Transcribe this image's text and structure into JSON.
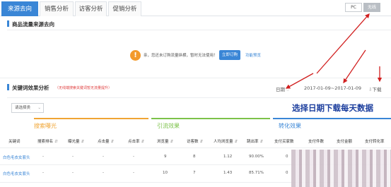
{
  "tabs": [
    {
      "label": "来源去向",
      "active": true
    },
    {
      "label": "销售分析",
      "active": false
    },
    {
      "label": "访客分析",
      "active": false
    },
    {
      "label": "促销分析",
      "active": false
    }
  ],
  "device_switch": {
    "pc": "PC",
    "wireless": "无线",
    "selected": "wireless"
  },
  "section_flow": {
    "title": "商品流量来源去向"
  },
  "notice": {
    "icon": "!",
    "text": "亲，您还未订购流量纵横，暂时无法使用！",
    "button": "立即订购",
    "link": "功能预览"
  },
  "section_keywords": {
    "title": "关键词效果分析",
    "note": "（无线端搜索关键词暂无流量提升）",
    "date_label": "日期",
    "date_range": "2017-01-09~2017-01-09",
    "download": "下载"
  },
  "filter": {
    "value": "请选择类"
  },
  "annotation": "选择日期下载每天数据",
  "groups": [
    {
      "label": "搜索曝光",
      "color": "#f0a534"
    },
    {
      "label": "引流效果",
      "color": "#7cc24a"
    },
    {
      "label": "转化效果",
      "color": "#3a86d6"
    }
  ],
  "table": {
    "headers": [
      "关键词",
      "搜索排名",
      "曝光量",
      "点击量",
      "点击率",
      "浏览量",
      "访客数",
      "人均浏览量",
      "跳出率",
      "支付买家数",
      "支付件数",
      "支付金额",
      "支付转化率"
    ],
    "rows": [
      {
        "keyword": "白色毛衣女套头",
        "rank": "-",
        "exposure": "-",
        "clicks": "-",
        "ctr": "-",
        "pv": "9",
        "uv": "8",
        "avg_pv": "1.12",
        "bounce": "90.00%",
        "buyers": "0",
        "items": "0",
        "amount": "0",
        "conv": "0"
      },
      {
        "keyword": "白色毛衣女套头",
        "rank": "-",
        "exposure": "-",
        "clicks": "-",
        "ctr": "-",
        "pv": "10",
        "uv": "7",
        "avg_pv": "1.43",
        "bounce": "85.71%",
        "buyers": "0",
        "items": "0",
        "amount": "0",
        "conv": "0"
      }
    ]
  },
  "colors": {
    "accent": "#3a86d6",
    "annotation_arrow": "#d11f1f",
    "annotation_text": "#1d3f9e"
  },
  "icons": {
    "notice": "warning-icon",
    "sort": "sort-icon",
    "download": "download-icon",
    "dropdown": "chevron-down-icon"
  }
}
